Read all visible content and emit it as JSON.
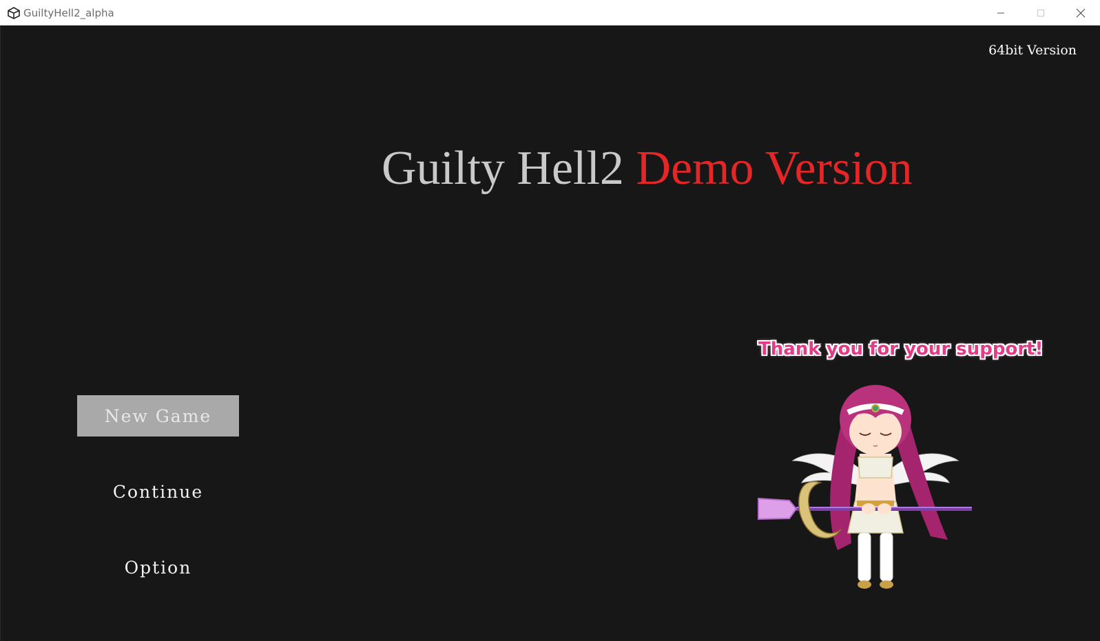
{
  "window": {
    "title": "GuiltyHell2_alpha",
    "icon": "unity-icon",
    "controls": [
      "minimize-icon",
      "maximize-icon",
      "close-icon"
    ]
  },
  "game": {
    "build_label": "64bit Version",
    "title_main": "Guilty Hell2",
    "title_sub": "Demo Version",
    "menu": {
      "new_game": "New Game",
      "continue": "Continue",
      "option": "Option",
      "selected": "New Game"
    },
    "thanks_text": "Thank you for your support!",
    "colors": {
      "background": "#171717",
      "title_main": "#c9c9c9",
      "title_sub": "#e42626",
      "menu_selected_bg": "#a9a9a9",
      "thanks_text": "#e23c86"
    }
  }
}
